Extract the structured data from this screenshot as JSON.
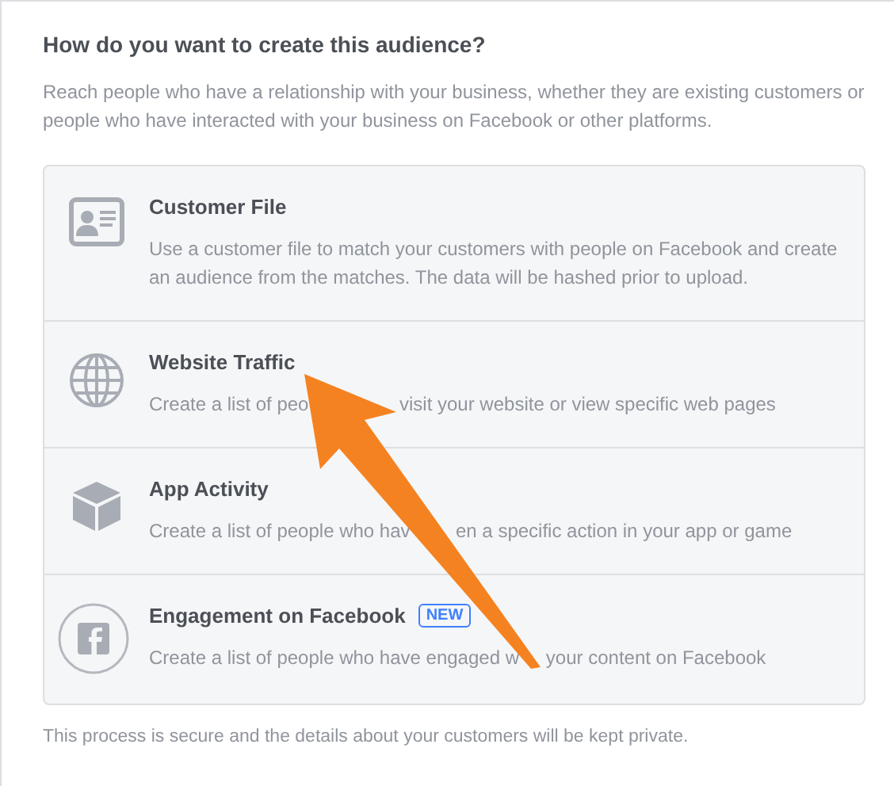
{
  "heading": "How do you want to create this audience?",
  "intro": "Reach people who have a relationship with your business, whether they are existing customers or people who have interacted with your business on Facebook or other platforms.",
  "options": [
    {
      "kind": "file",
      "title": "Customer File",
      "description_parts": [
        "Use a customer file to match your customers with people on Facebook and create an audience from the matches. The data will be hashed prior to upload."
      ]
    },
    {
      "kind": "website",
      "title": "Website Traffic",
      "description_parts": [
        "Create a list of peo",
        "visit your website or view specific web pages"
      ]
    },
    {
      "kind": "app",
      "title": "App Activity",
      "description_parts": [
        "Create a list of people who hav",
        "en a specific action in your app or game"
      ]
    },
    {
      "kind": "facebook",
      "title": "Engagement on Facebook",
      "badge": "NEW",
      "description_parts": [
        "Create a list of people who have engaged w",
        "your content on Facebook"
      ]
    }
  ],
  "footer": "This process is secure and the details about your customers will be kept private."
}
